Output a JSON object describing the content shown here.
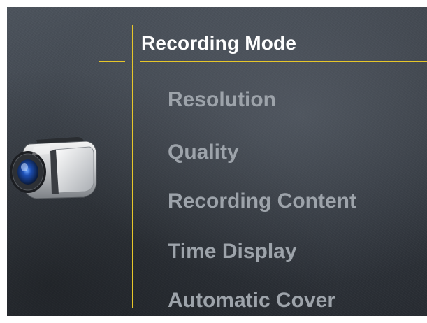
{
  "menu": {
    "title": "Recording Mode",
    "items": [
      {
        "label": "Resolution"
      },
      {
        "label": "Quality"
      },
      {
        "label": "Recording Content"
      },
      {
        "label": "Time Display"
      },
      {
        "label": "Automatic Cover"
      }
    ]
  },
  "icons": {
    "camera": "camcorder-icon"
  },
  "colors": {
    "accent": "#e6c62a",
    "title_text": "#ffffff",
    "item_text": "#9da3aa",
    "background": "#3e444c"
  }
}
